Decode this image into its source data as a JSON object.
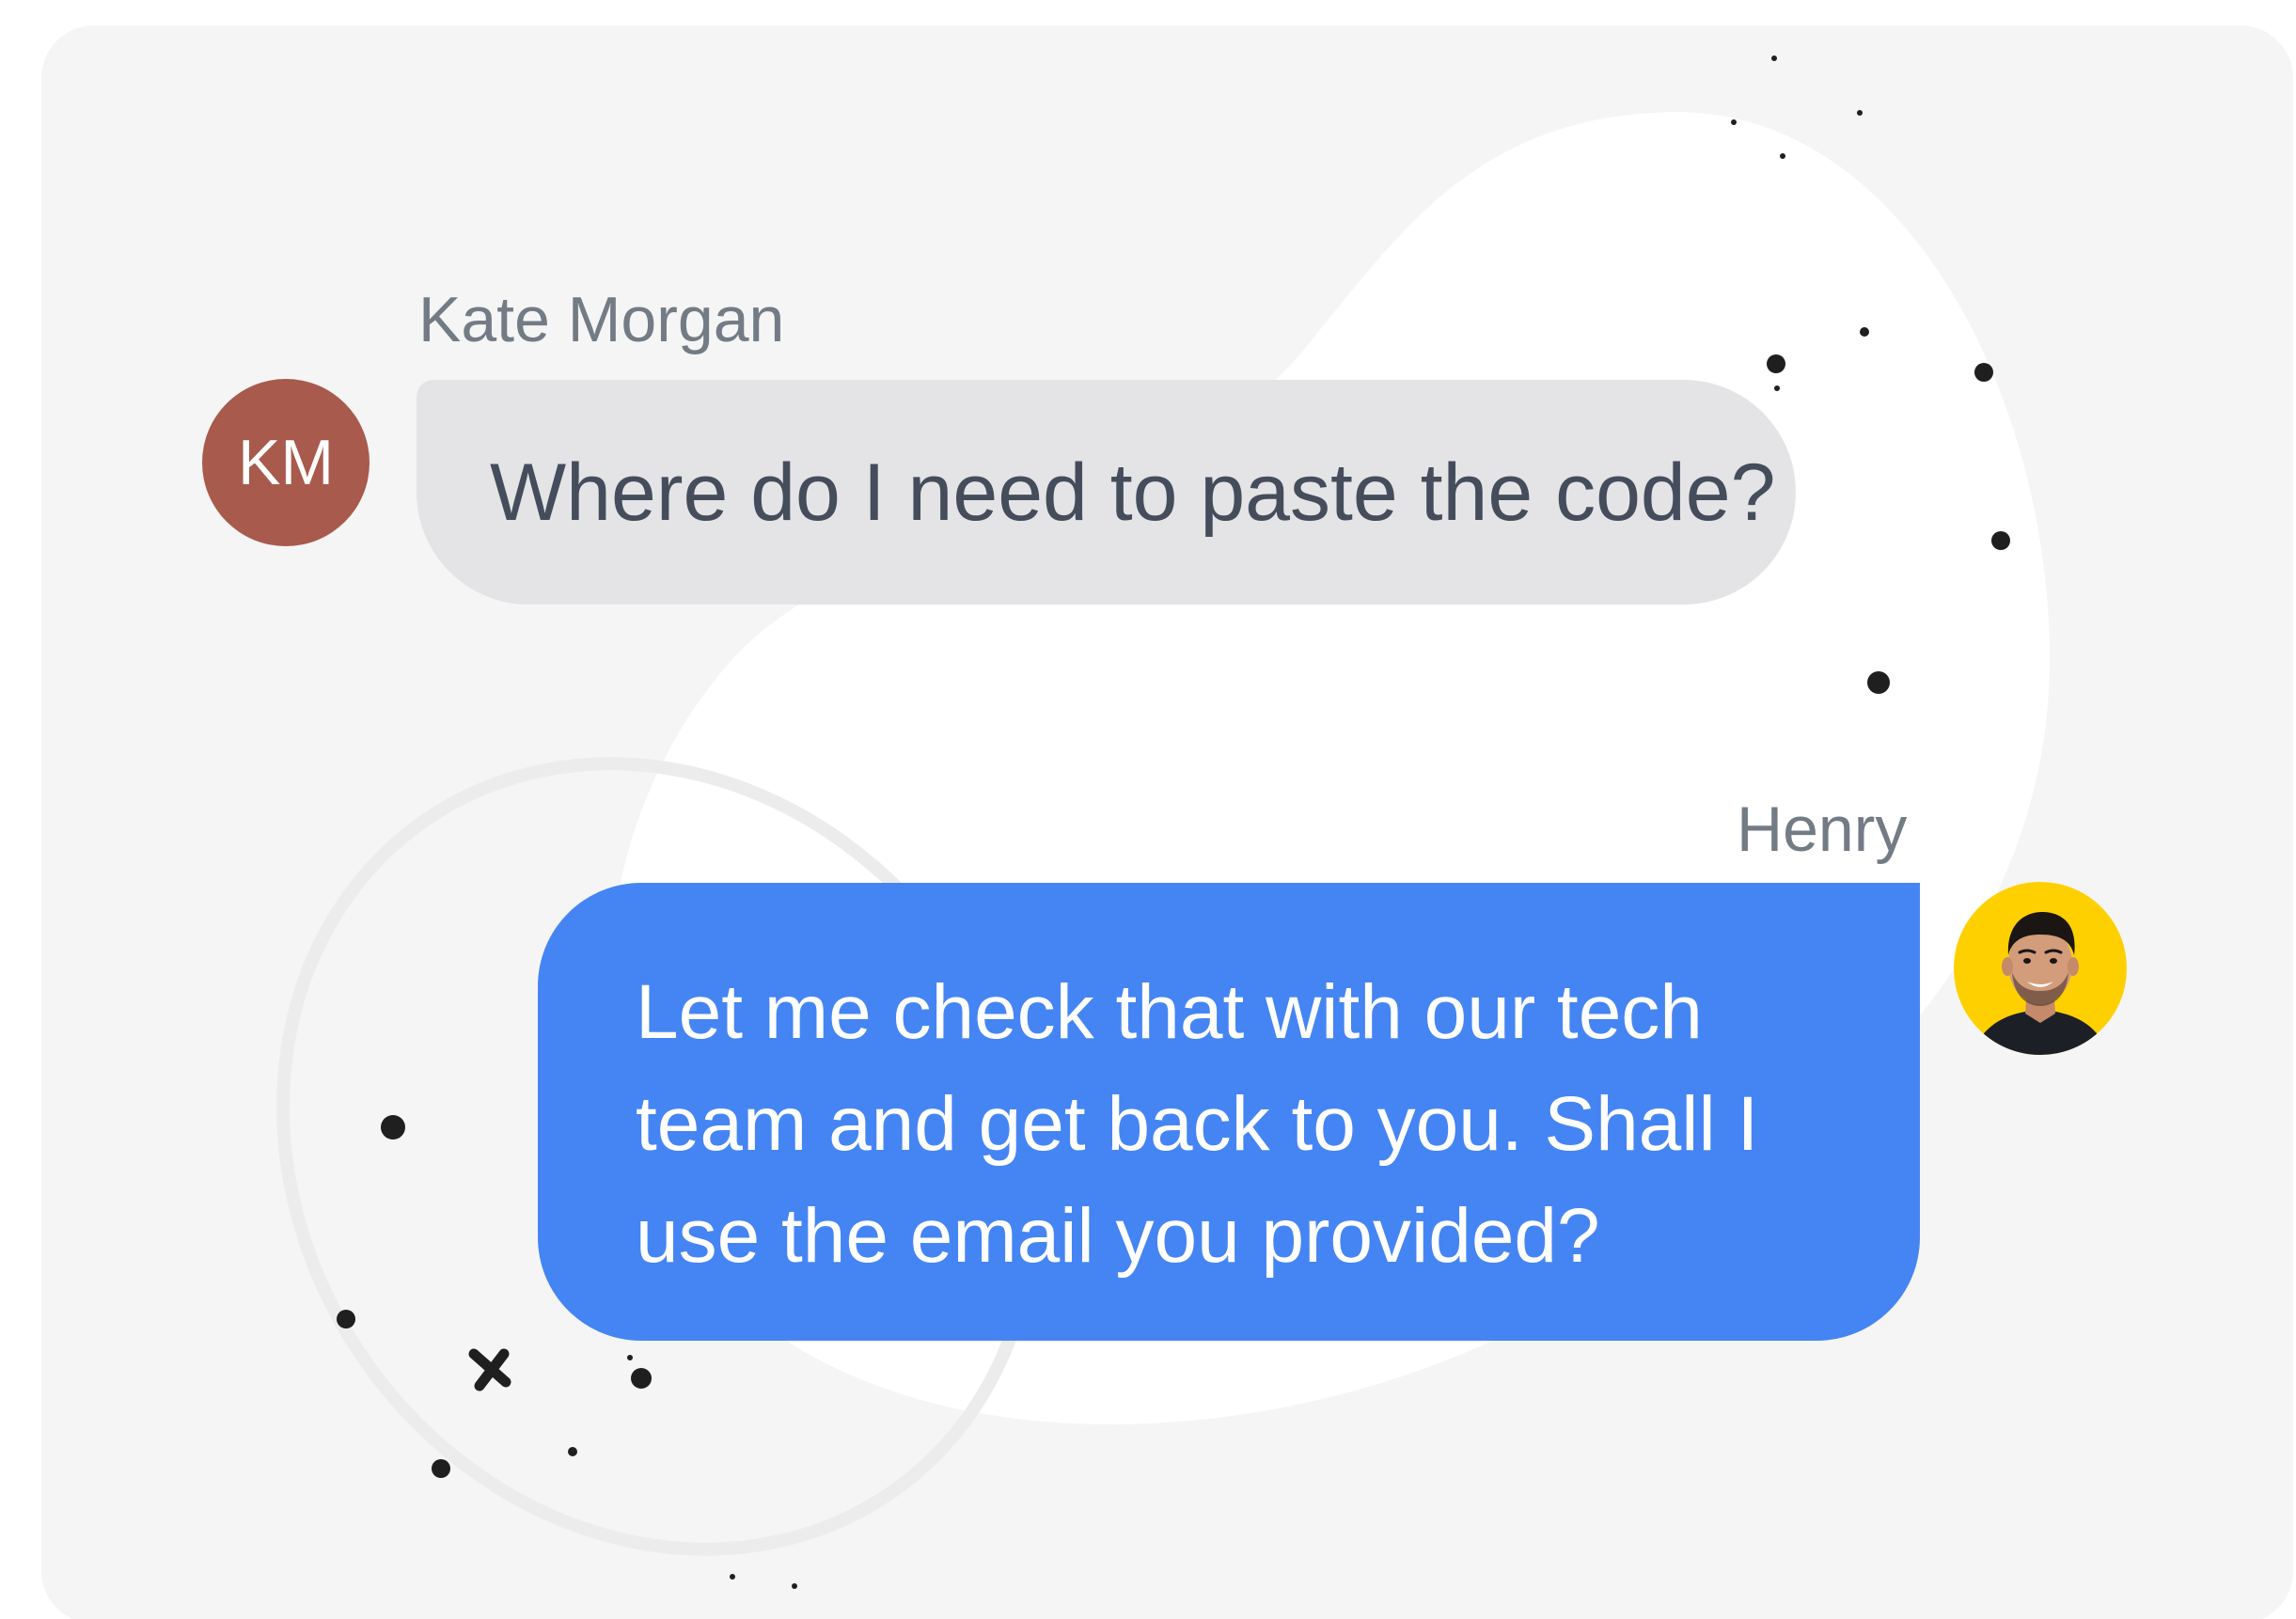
{
  "conversation": {
    "messages": [
      {
        "sender": "Kate Morgan",
        "initials": "KM",
        "text": "Where do I need to paste the code?"
      },
      {
        "sender": "Henry",
        "text": "Let me check that with our tech team and get back to you. Shall I use the email you provided?"
      }
    ]
  },
  "colors": {
    "card_background": "#f5f5f5",
    "incoming_bubble": "#e4e4e6",
    "outgoing_bubble": "#4585f3",
    "kate_avatar": "#a85a4c",
    "henry_avatar_background": "#ffd000",
    "name_text": "#737b85"
  },
  "icons": {
    "henry_avatar": "person-photo-avatar"
  }
}
